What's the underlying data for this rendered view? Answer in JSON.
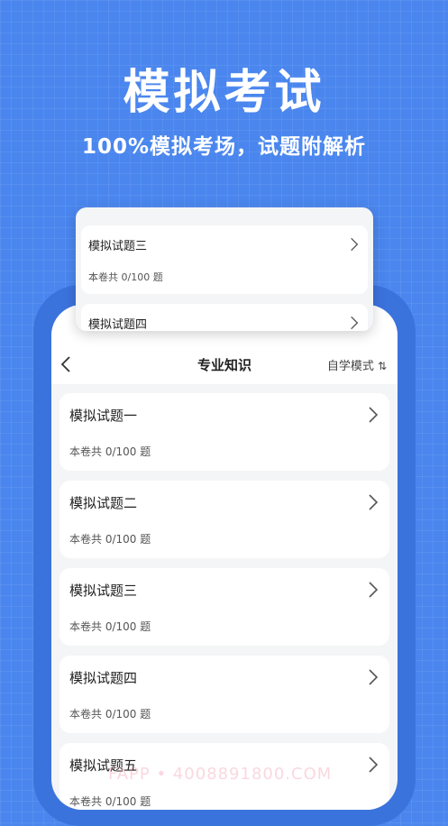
{
  "hero": {
    "title": "模拟考试",
    "subtitle": "100%模拟考场，试题附解析"
  },
  "popup": {
    "items": [
      {
        "name": "模拟试题三",
        "count": "本卷共 0/100 题"
      },
      {
        "name": "模拟试题四"
      }
    ]
  },
  "nav": {
    "back_icon": "chevron-left-icon",
    "title": "专业知识",
    "mode_label": "自学模式",
    "mode_icon": "sort-icon"
  },
  "list": {
    "items": [
      {
        "name": "模拟试题一",
        "count": "本卷共 0/100 题"
      },
      {
        "name": "模拟试题二",
        "count": "本卷共 0/100 题"
      },
      {
        "name": "模拟试题三",
        "count": "本卷共 0/100 题"
      },
      {
        "name": "模拟试题四",
        "count": "本卷共 0/100 题"
      },
      {
        "name": "模拟试题五",
        "count": "本卷共 0/100 题"
      }
    ]
  },
  "watermark": "FAPP • 4008891800.COM",
  "colors": {
    "background": "#4a86ee",
    "phone_frame": "#3b73dd",
    "card": "#ffffff",
    "screen": "#f4f5f7"
  }
}
